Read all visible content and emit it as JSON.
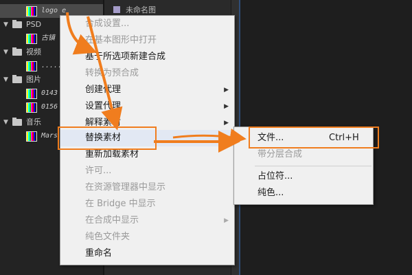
{
  "project_panel": {
    "rows": [
      {
        "kind": "item",
        "label": "logo e",
        "selected": true
      },
      {
        "kind": "folder",
        "label": "PSD"
      },
      {
        "kind": "item",
        "label": "古镇"
      },
      {
        "kind": "folder",
        "label": "视频"
      },
      {
        "kind": "item",
        "label": "......."
      },
      {
        "kind": "folder",
        "label": "图片"
      },
      {
        "kind": "item",
        "label": "0143"
      },
      {
        "kind": "item",
        "label": "0156"
      },
      {
        "kind": "folder",
        "label": "音乐"
      },
      {
        "kind": "item",
        "label": "Mars"
      }
    ],
    "top_right_item": "未命名图"
  },
  "context_menu": {
    "items": [
      {
        "label": "合成设置...",
        "disabled": true,
        "submenu": false
      },
      {
        "label": "在基本图形中打开",
        "disabled": true,
        "submenu": false
      },
      {
        "label": "基于所选项新建合成",
        "disabled": false,
        "submenu": false
      },
      {
        "label": "转换为预合成",
        "disabled": true,
        "submenu": false
      },
      {
        "label": "创建代理",
        "disabled": false,
        "submenu": true
      },
      {
        "label": "设置代理",
        "disabled": false,
        "submenu": true
      },
      {
        "label": "解释素材",
        "disabled": false,
        "submenu": true
      },
      {
        "label": "替换素材",
        "disabled": false,
        "submenu": true,
        "highlighted": true
      },
      {
        "label": "重新加载素材",
        "disabled": false,
        "submenu": false
      },
      {
        "label": "许可...",
        "disabled": true,
        "submenu": false
      },
      {
        "label": "在资源管理器中显示",
        "disabled": true,
        "submenu": false
      },
      {
        "label": "在 Bridge 中显示",
        "disabled": true,
        "submenu": false
      },
      {
        "label": "在合成中显示",
        "disabled": true,
        "submenu": true
      },
      {
        "label": "纯色文件夹",
        "disabled": true,
        "submenu": false
      },
      {
        "label": "重命名",
        "disabled": false,
        "submenu": false
      }
    ]
  },
  "submenu": {
    "items": [
      {
        "label": "文件...",
        "shortcut": "Ctrl+H",
        "disabled": false
      },
      {
        "label": "带分层合成",
        "shortcut": "",
        "disabled": true
      },
      {
        "label": "占位符...",
        "shortcut": "",
        "disabled": false
      },
      {
        "label": "纯色...",
        "shortcut": "",
        "disabled": false
      }
    ]
  },
  "colors": {
    "annotation": "#f07d1e",
    "menu_bg": "#f0f0f0",
    "disabled_text": "#9a9a9a"
  }
}
